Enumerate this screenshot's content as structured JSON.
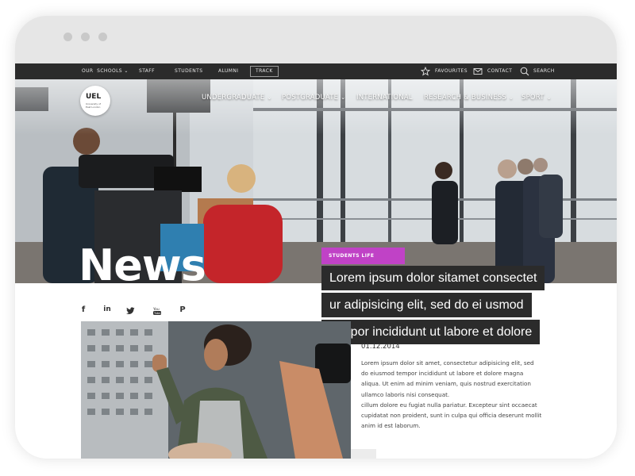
{
  "topbar": {
    "our_label": "OUR",
    "schools_label": "SCHOOLS",
    "staff_label": "STAFF",
    "students_label": "STUDENTS",
    "alumni_label": "ALUMNI",
    "track_label": "TRACK",
    "favourites_label": "FAVOURITES",
    "contact_label": "CONTACT",
    "search_label": "SEARCH"
  },
  "logo": {
    "text": "UEL",
    "subtext": "University of East London"
  },
  "nav": {
    "undergraduate": "UNDERGRADUATE",
    "postgraduate": "POSTGRADUATE",
    "international": "INTERNATIONAL",
    "research": "RESEARCH & BUSINESS",
    "sport": "SPORT"
  },
  "hero": {
    "title": "News",
    "tag": "STUDENTS LIFE",
    "headline_lines": [
      "Lorem ipsum dolor sitamet consectet",
      "ur adipisicing elit, sed do ei usmod",
      "tempor incididunt ut labore et dolore"
    ]
  },
  "article": {
    "date": "01.12.2014",
    "lines": [
      "Lorem ipsum dolor sit amet, consectetur adipisicing elit, sed",
      "do eiusmod tempor incididunt ut labore et dolore magna",
      "aliqua. Ut enim ad minim veniam, quis nostrud exercitation",
      "ullamco laboris nisi consequat.",
      "cillum dolore eu fugiat nulla pariatur. Excepteur sint occaecat",
      "cupidatat non proident, sunt in culpa qui officia deserunt mollit",
      "anim id est laborum."
    ]
  },
  "social": [
    "facebook-icon",
    "linkedin-icon",
    "twitter-icon",
    "youtube-icon",
    "pinterest-icon"
  ],
  "colors": {
    "topbar": "#2b2b2b",
    "tag": "#c042c6",
    "headline_bg": "#2b2b2b"
  }
}
